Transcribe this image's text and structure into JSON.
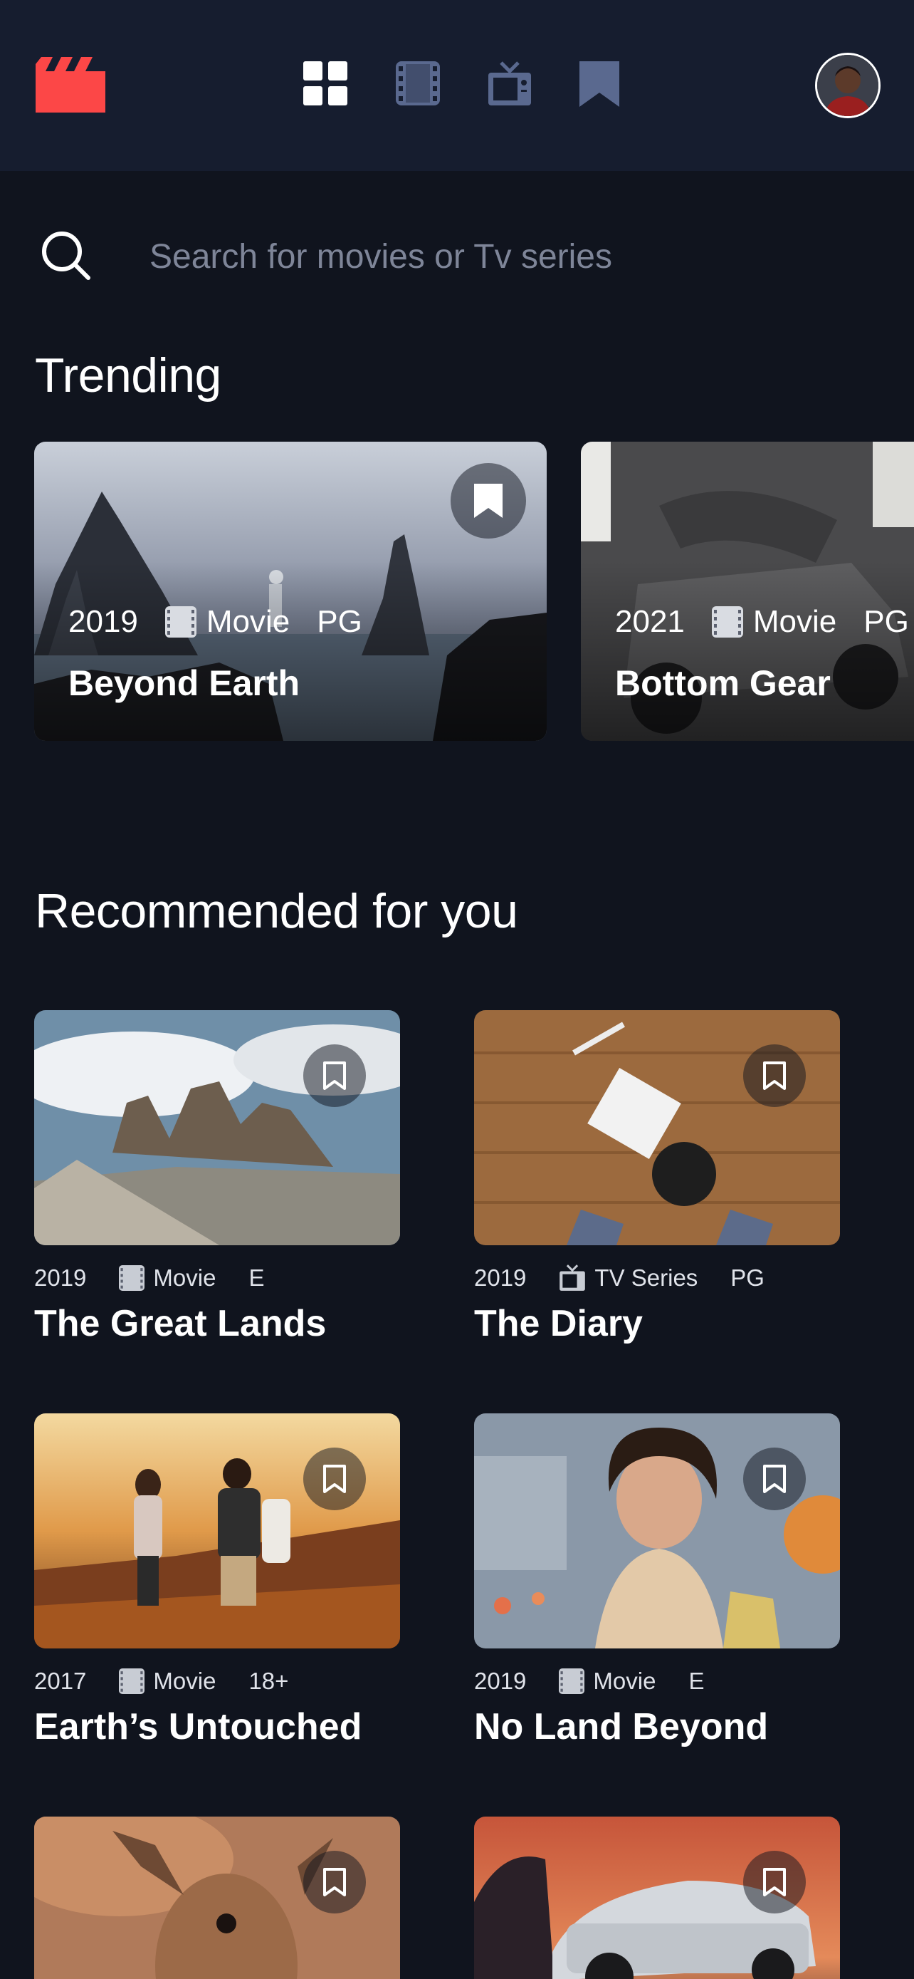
{
  "header": {
    "nav": [
      {
        "icon": "home-grid-icon",
        "active": true
      },
      {
        "icon": "movies-icon",
        "active": false
      },
      {
        "icon": "tv-series-icon",
        "active": false
      },
      {
        "icon": "bookmarks-icon",
        "active": false
      }
    ],
    "avatar": "user-avatar"
  },
  "search": {
    "placeholder": "Search for movies or Tv series"
  },
  "trending": {
    "title": "Trending",
    "items": [
      {
        "year": "2019",
        "category": "Movie",
        "rating": "PG",
        "title": "Beyond Earth"
      },
      {
        "year": "2021",
        "category": "Movie",
        "rating": "PG",
        "title": "Bottom Gear"
      }
    ]
  },
  "recommended": {
    "title": "Recommended for you",
    "items": [
      {
        "year": "2019",
        "category": "Movie",
        "rating": "E",
        "title": "The Great Lands"
      },
      {
        "year": "2019",
        "category": "TV Series",
        "rating": "PG",
        "title": "The Diary"
      },
      {
        "year": "2017",
        "category": "Movie",
        "rating": "18+",
        "title": "Earth’s Untouched"
      },
      {
        "year": "2019",
        "category": "Movie",
        "rating": "E",
        "title": "No Land Beyond"
      },
      {
        "year": "",
        "category": "",
        "rating": "",
        "title": ""
      },
      {
        "year": "",
        "category": "",
        "rating": "",
        "title": ""
      }
    ]
  },
  "colors": {
    "background": "#10141E",
    "header": "#161D2F",
    "brand": "#FC4747",
    "nav_inactive": "#5A698F",
    "placeholder": "#7E8598"
  }
}
